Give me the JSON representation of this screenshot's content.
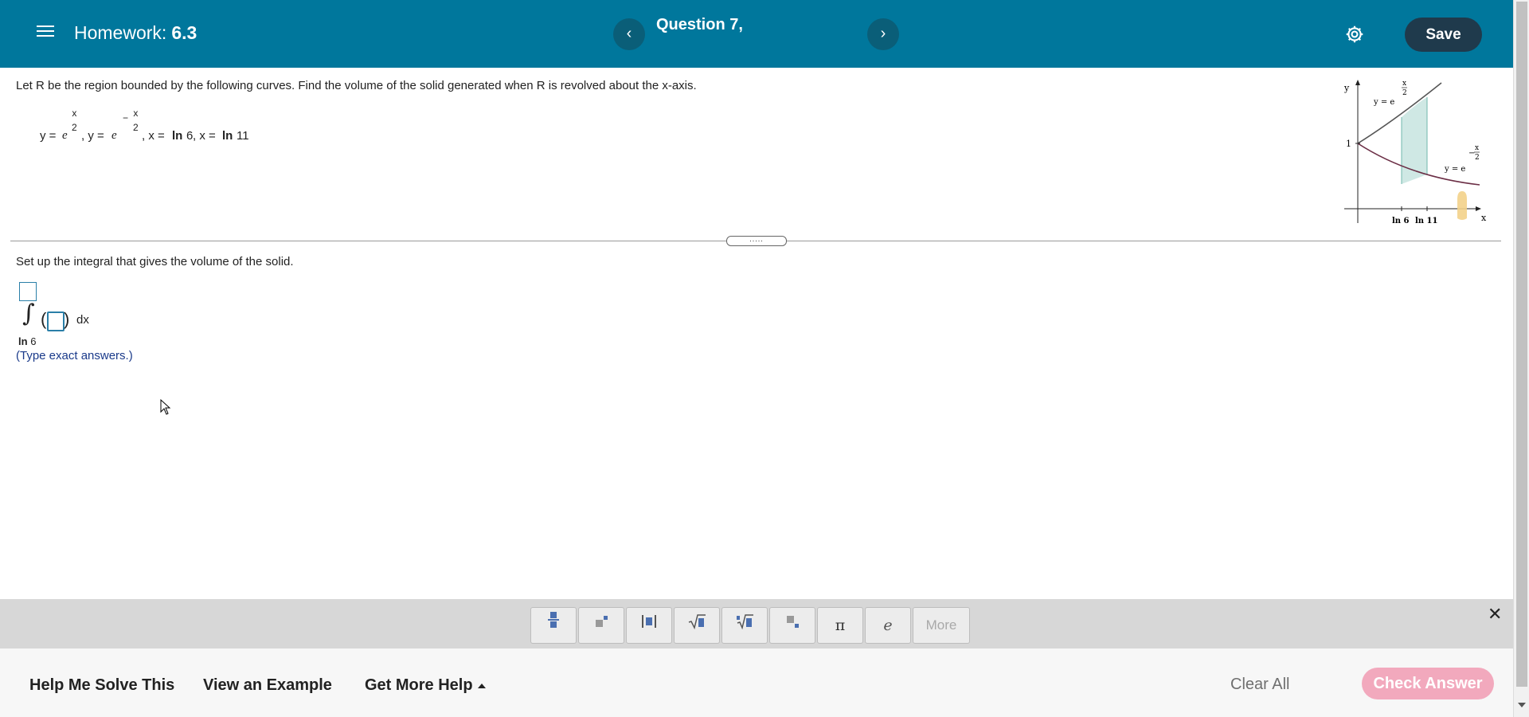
{
  "header": {
    "homework_label": "Homework:",
    "homework_number": "6.3",
    "question_title": "Question 7,",
    "prev_symbol": "‹",
    "next_symbol": "›",
    "save_label": "Save",
    "background_color": "#00779c"
  },
  "problem": {
    "prompt": "Let R be the region bounded by the following curves. Find the volume of the solid generated when R is revolved about the x-axis.",
    "eq_y1": "y = ",
    "eq_e": "e",
    "eq_x": "x",
    "eq_2": "2",
    "eq_sep1": ", y = ",
    "eq_minus": "−",
    "eq_sep2": ", x = ",
    "eq_ln": "ln",
    "eq_6": "6",
    "eq_sep3": ", x = ",
    "eq_11": "11"
  },
  "figure": {
    "y_axis_label": "y",
    "x_axis_label": "x",
    "one_label": "1",
    "curve_up_label": "y = e",
    "curve_down_label": "y = e",
    "exp_num": "x",
    "exp_den": "2",
    "exp_minus": "−",
    "tick_ln6": "ln 6",
    "tick_ln11": "ln 11"
  },
  "answer": {
    "setup_text": "Set up the integral that gives the volume of the solid.",
    "lower_limit_ln": "ln",
    "lower_limit_num": "6",
    "open_paren": "(",
    "close_paren": ")",
    "dx": "dx",
    "hint": "(Type exact answers.)",
    "divider_handle": "....."
  },
  "palette": {
    "buttons": [
      "fraction",
      "exponent",
      "absolute-value",
      "sqrt",
      "nth-root",
      "subscript",
      "pi",
      "e"
    ],
    "pi_symbol": "π",
    "e_symbol": "e",
    "more_label": "More",
    "close_symbol": "✕"
  },
  "footer": {
    "help_solve": "Help Me Solve This",
    "view_example": "View an Example",
    "get_more_help": "Get More Help",
    "clear_all": "Clear All",
    "check_answer": "Check Answer"
  }
}
